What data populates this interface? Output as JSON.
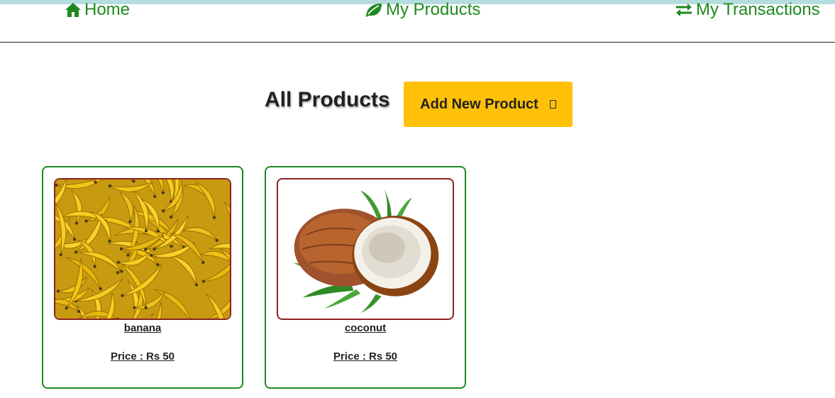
{
  "nav": {
    "home": {
      "label": "Home",
      "icon": "home-icon"
    },
    "products": {
      "label": "My Products",
      "icon": "leaf-icon"
    },
    "transactions": {
      "label": "My Transactions",
      "icon": "exchange-icon"
    }
  },
  "colors": {
    "nav_text": "#1f8a1f",
    "card_border": "#1f8a1f",
    "image_border": "#8b2323",
    "button_bg": "#ffc107",
    "top_strip": "#b5dde0"
  },
  "page": {
    "title": "All Products",
    "add_button_label": "Add New Product"
  },
  "products": [
    {
      "name": "banana",
      "price_text": "Price : Rs 50",
      "image": "banana-image"
    },
    {
      "name": "coconut",
      "price_text": "Price : Rs 50",
      "image": "coconut-image"
    }
  ]
}
